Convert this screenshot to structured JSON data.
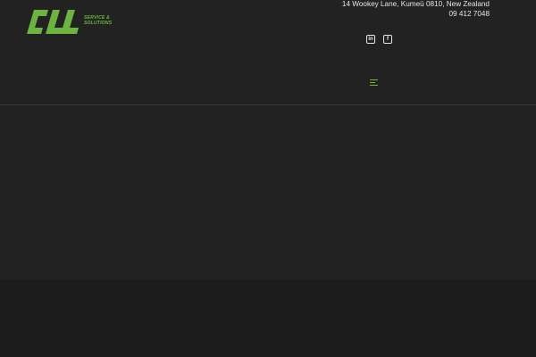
{
  "brand": {
    "name": "CLL",
    "tagline_line1": "SERVICE &",
    "tagline_line2": "SOLUTIONS",
    "accent_color": "#6cb33f"
  },
  "contact": {
    "address": "14 Wookey Lane, Kumeū 0810, New Zealand",
    "phone": "09 412 7048"
  },
  "social": [
    {
      "icon": "linkedin-icon",
      "glyph": "in"
    },
    {
      "icon": "facebook-icon",
      "glyph": "f"
    }
  ],
  "menu": {
    "icon": "hamburger-menu-icon"
  }
}
